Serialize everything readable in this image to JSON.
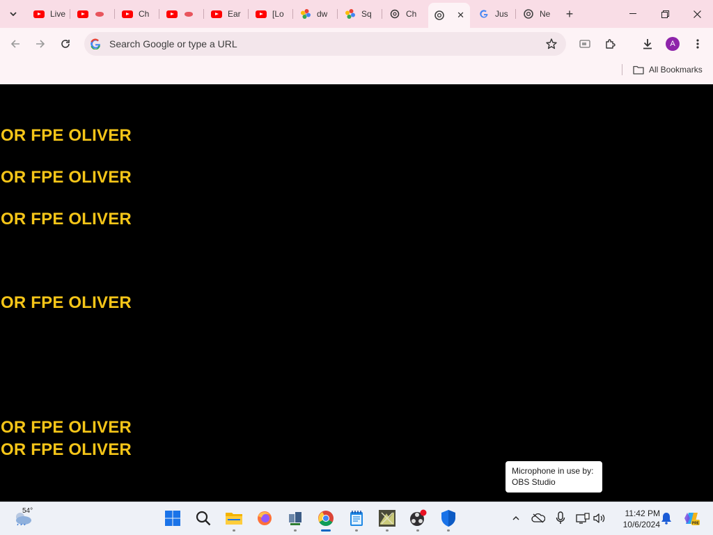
{
  "browser": {
    "tabs": [
      {
        "icon": "youtube-icon",
        "title": "Live"
      },
      {
        "icon": "youtube-icon",
        "title": ""
      },
      {
        "icon": "youtube-icon",
        "title": "Ch"
      },
      {
        "icon": "youtube-icon",
        "title": ""
      },
      {
        "icon": "youtube-icon",
        "title": "Ear"
      },
      {
        "icon": "youtube-icon",
        "title": "[Lo"
      },
      {
        "icon": "pinwheel-icon",
        "title": "dw"
      },
      {
        "icon": "pinwheel-icon",
        "title": "Sq"
      },
      {
        "icon": "chatgpt-icon",
        "title": "Ch"
      },
      {
        "icon": "chrome-icon",
        "title": ""
      },
      {
        "icon": "google-icon",
        "title": "Jus"
      },
      {
        "icon": "chrome-icon",
        "title": "Ne"
      }
    ],
    "active_tab_index": 9,
    "new_tab_symbol": "+",
    "omnibox_placeholder": "Search Google or type a URL",
    "avatar_letter": "A",
    "bookmarks_label": "All Bookmarks",
    "colors": {
      "tabstrip": "#f9dde6",
      "toolbar": "#fdf3f6",
      "text_yellow": "#f5c518"
    }
  },
  "page": {
    "lines": [
      "OR FPE OLIVER",
      "OR FPE OLIVER",
      "OR FPE OLIVER",
      "OR FPE OLIVER",
      "OR FPE OLIVER",
      "OR FPE OLIVER"
    ]
  },
  "tooltip": {
    "line1": "Microphone in use by:",
    "line2": "OBS Studio"
  },
  "taskbar": {
    "weather_temp": "54°",
    "apps": [
      "start-icon",
      "search-icon",
      "file-explorer-icon",
      "firefox-icon",
      "network-app-icon",
      "chrome-icon",
      "notepad-icon",
      "game-app-icon",
      "obs-icon",
      "defender-icon"
    ],
    "time": "11:42 PM",
    "date": "10/6/2024"
  }
}
